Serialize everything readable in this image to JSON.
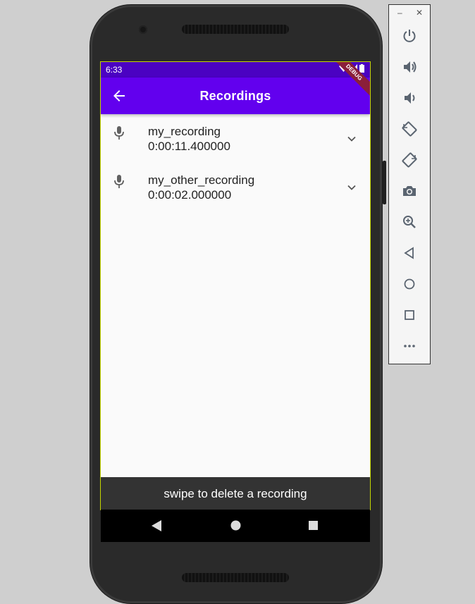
{
  "status_bar": {
    "time": "6:33"
  },
  "app_bar": {
    "title": "Recordings",
    "debug_banner": "DEBUG"
  },
  "recordings": [
    {
      "name": "my_recording",
      "duration": "0:00:11.400000"
    },
    {
      "name": "my_other_recording",
      "duration": "0:00:02.000000"
    }
  ],
  "snackbar": {
    "message": "swipe to delete a recording"
  },
  "colors": {
    "app_bar": "#6200ee",
    "status_bar": "#4b02c2",
    "background": "#fafafa",
    "snackbar": "#333333",
    "debug_ribbon": "#8b1f3a"
  },
  "emulator_toolbar": {
    "window_controls": [
      "minimize-icon",
      "close-icon"
    ],
    "buttons": [
      "power-icon",
      "volume-up-icon",
      "volume-down-icon",
      "rotate-left-icon",
      "rotate-right-icon",
      "camera-icon",
      "zoom-icon",
      "back-icon",
      "home-icon",
      "overview-icon",
      "more-icon"
    ]
  }
}
